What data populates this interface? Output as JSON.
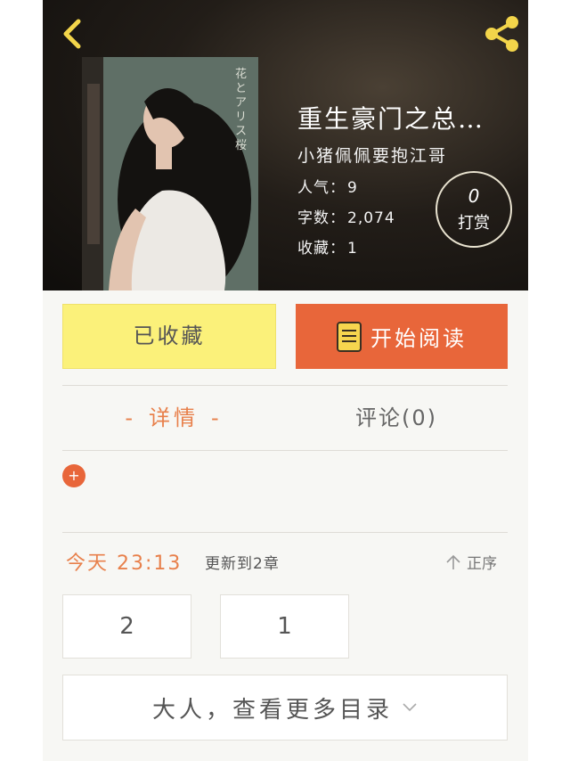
{
  "header": {
    "book_title": "重生豪门之总…",
    "author": "小猪佩佩要抱江哥",
    "stats": {
      "popularity_label": "人气：",
      "popularity_value": "9",
      "word_count_label": "字数：",
      "word_count_value": "2,074",
      "favorites_label": "收藏：",
      "favorites_value": "1"
    },
    "tip": {
      "count": "0",
      "label": "打赏"
    },
    "cover_text": "花とアリス 桜"
  },
  "actions": {
    "favorite_label": "已收藏",
    "read_label": "开始阅读"
  },
  "tabs": {
    "details_label": "详情",
    "details_dash": "-",
    "comments_label": "评论(0)"
  },
  "expand_symbol": "+",
  "update": {
    "time": "今天 23:13",
    "text": "更新到2章",
    "sort_label": "正序"
  },
  "chapters": [
    {
      "label": "2"
    },
    {
      "label": "1"
    }
  ],
  "more_catalog_label": "大人，查看更多目录",
  "colors": {
    "accent_orange": "#e8663a",
    "favorite_yellow": "#fbf17a",
    "icon_yellow": "#f3d54a"
  },
  "icons": {
    "back": "back-arrow-icon",
    "share": "share-icon",
    "read": "book-icon",
    "sort": "arrow-up-icon",
    "more": "chevron-down-icon"
  }
}
